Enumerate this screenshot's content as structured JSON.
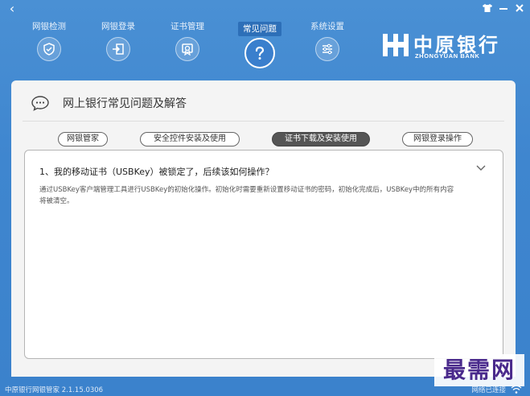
{
  "window": {
    "back_glyph": "‹",
    "controls": [
      "shirt-icon",
      "minimize-icon",
      "close-icon"
    ]
  },
  "nav": {
    "items": [
      {
        "label": "网银检测",
        "icon": "shield-icon"
      },
      {
        "label": "网银登录",
        "icon": "login-icon"
      },
      {
        "label": "证书管理",
        "icon": "certificate-icon"
      },
      {
        "label": "常见问题",
        "icon": "question-icon",
        "active": true
      },
      {
        "label": "系统设置",
        "icon": "settings-icon"
      }
    ]
  },
  "logo": {
    "cn": "中原银行",
    "en": "ZHONGYUAN BANK"
  },
  "panel": {
    "title": "网上银行常见问题及解答",
    "tabs": [
      {
        "label": "网银管家"
      },
      {
        "label": "安全控件安装及使用"
      },
      {
        "label": "证书下载及安装使用",
        "active": true
      },
      {
        "label": "网银登录操作"
      }
    ],
    "faq": {
      "question": "1、我的移动证书（USBKey）被锁定了，后续该如何操作？",
      "answer": "通过USBKey客户端管理工具进行USBKey的初始化操作。初始化时需要重新设置移动证书的密码，初始化完成后，USBKey中的所有内容将被清空。"
    }
  },
  "status": {
    "version": "中原银行网银管家 2.1.15.0306",
    "network": "网络已连接"
  },
  "watermark": "最需网",
  "colors": {
    "accent_blue": "#3f86cf",
    "active_tab": "#555555",
    "watermark": "#4a2a8c"
  }
}
